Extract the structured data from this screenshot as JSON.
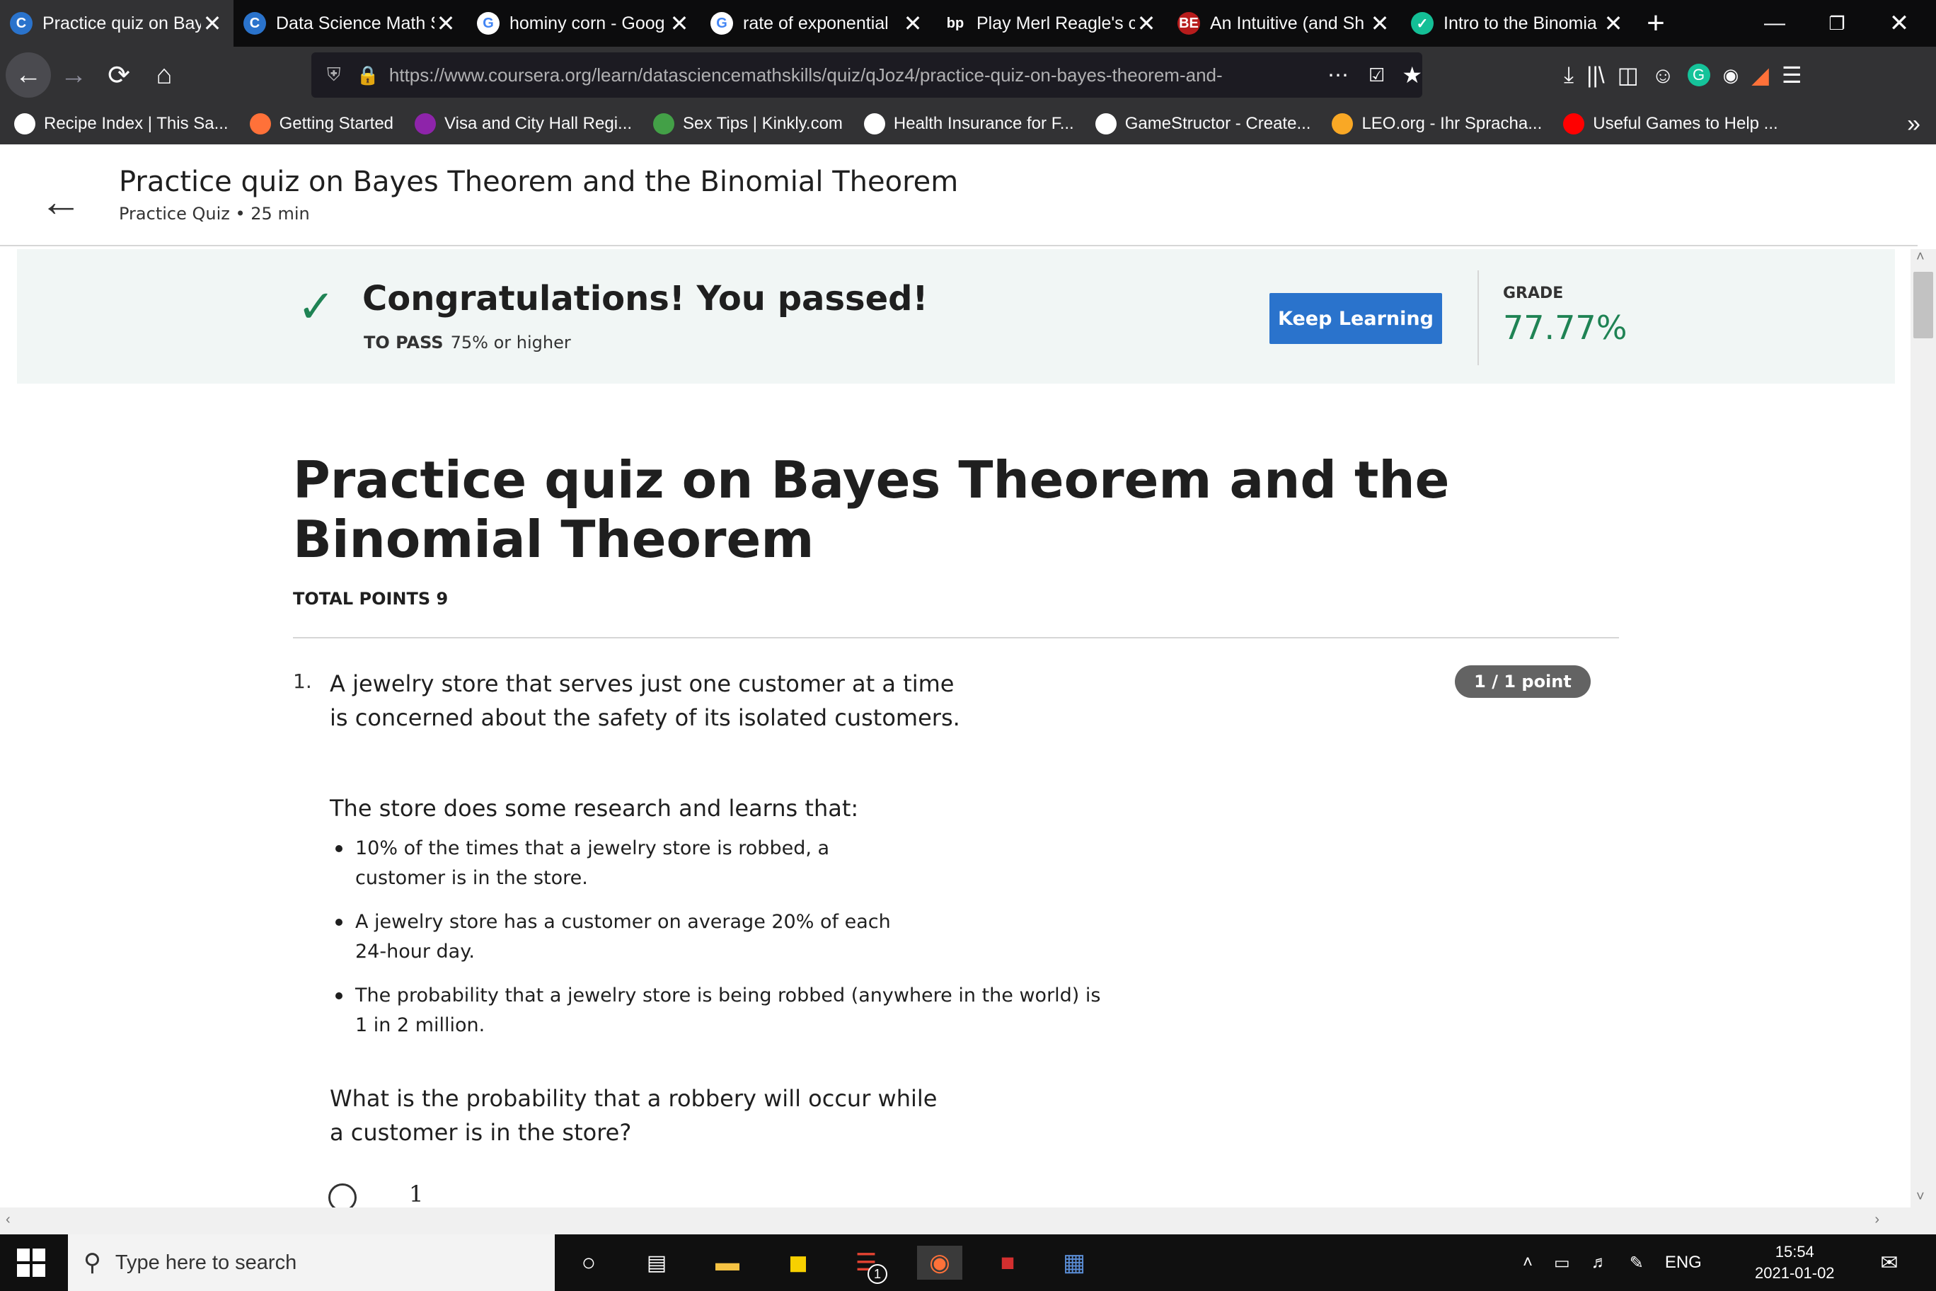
{
  "browser": {
    "tabs": [
      {
        "title": "Practice quiz on Bay",
        "icon": "coursera-icon",
        "icon_color": "#2a73cc",
        "icon_glyph": "C",
        "active": true
      },
      {
        "title": "Data Science Math S",
        "icon": "coursera-icon",
        "icon_color": "#2a73cc",
        "icon_glyph": "C"
      },
      {
        "title": "hominy corn - Goog",
        "icon": "google-icon",
        "icon_color": "#ffffff",
        "icon_glyph": "G"
      },
      {
        "title": "rate of exponential",
        "icon": "google-icon",
        "icon_color": "#ffffff",
        "icon_glyph": "G"
      },
      {
        "title": "Play Merl Reagle's c",
        "icon": "bp-icon",
        "icon_color": "#0c0c0d",
        "icon_glyph": "bp"
      },
      {
        "title": "An Intuitive (and Sh",
        "icon": "betterexplained-icon",
        "icon_color": "#b71c1c",
        "icon_glyph": "BE"
      },
      {
        "title": "Intro to the Binomia",
        "icon": "khan-icon",
        "icon_color": "#14bf96",
        "icon_glyph": "✓"
      }
    ],
    "url_domain": "https://www.coursera.org",
    "url_path": "/learn/datasciencemathskills/quiz/qJoz4/practice-quiz-on-bayes-theorem-and-",
    "bookmarks": [
      {
        "label": "Recipe Index | This Sa...",
        "icon": "recipe-icon",
        "color": "#ffffff"
      },
      {
        "label": "Getting Started",
        "icon": "firefox-icon",
        "color": "#ff7139"
      },
      {
        "label": "Visa and City Hall Regi...",
        "icon": "visa-icon",
        "color": "#8e24aa"
      },
      {
        "label": "Sex Tips | Kinkly.com",
        "icon": "kinkly-icon",
        "color": "#43a047"
      },
      {
        "label": "Health Insurance for F...",
        "icon": "globe-icon",
        "color": "#ffffff"
      },
      {
        "label": "GameStructor - Create...",
        "icon": "globe-icon",
        "color": "#ffffff"
      },
      {
        "label": "LEO.org - Ihr Spracha...",
        "icon": "leo-icon",
        "color": "#f9a825"
      },
      {
        "label": "Useful Games to Help ...",
        "icon": "youtube-icon",
        "color": "#ff0000"
      }
    ]
  },
  "header": {
    "title": "Practice quiz on Bayes Theorem and the Binomial Theorem",
    "subtitle": "Practice Quiz • 25 min"
  },
  "banner": {
    "message": "Congratulations! You passed!",
    "to_pass_label": "TO PASS",
    "to_pass_value": "75% or higher",
    "button": "Keep Learning",
    "grade_label": "GRADE",
    "grade_value": "77.77%",
    "accent": "#1f8354",
    "button_color": "#2a73cc"
  },
  "quiz": {
    "title": "Practice quiz on Bayes Theorem and the Binomial Theorem",
    "total_points": "TOTAL POINTS 9",
    "question": {
      "number": "1.",
      "text": "A jewelry store that serves just one customer at a time is concerned about the safety of its isolated customers.",
      "points": "1 / 1 point",
      "intro": "The store does some research and learns that:",
      "bullets": [
        "10% of the times that a jewelry store is robbed, a customer is in the store.",
        "A jewelry store has a customer on average 20% of each 24-hour day.",
        "The probability that a jewelry store is being robbed (anywhere in the world) is 1 in 2 million."
      ],
      "prompt": "What is the probability that a robbery will occur while a customer is in the store?",
      "options": [
        "1"
      ]
    }
  },
  "taskbar": {
    "search_placeholder": "Type here to search",
    "lang": "ENG",
    "time": "15:54",
    "date": "2021-01-02",
    "todoist_badge": "1"
  }
}
